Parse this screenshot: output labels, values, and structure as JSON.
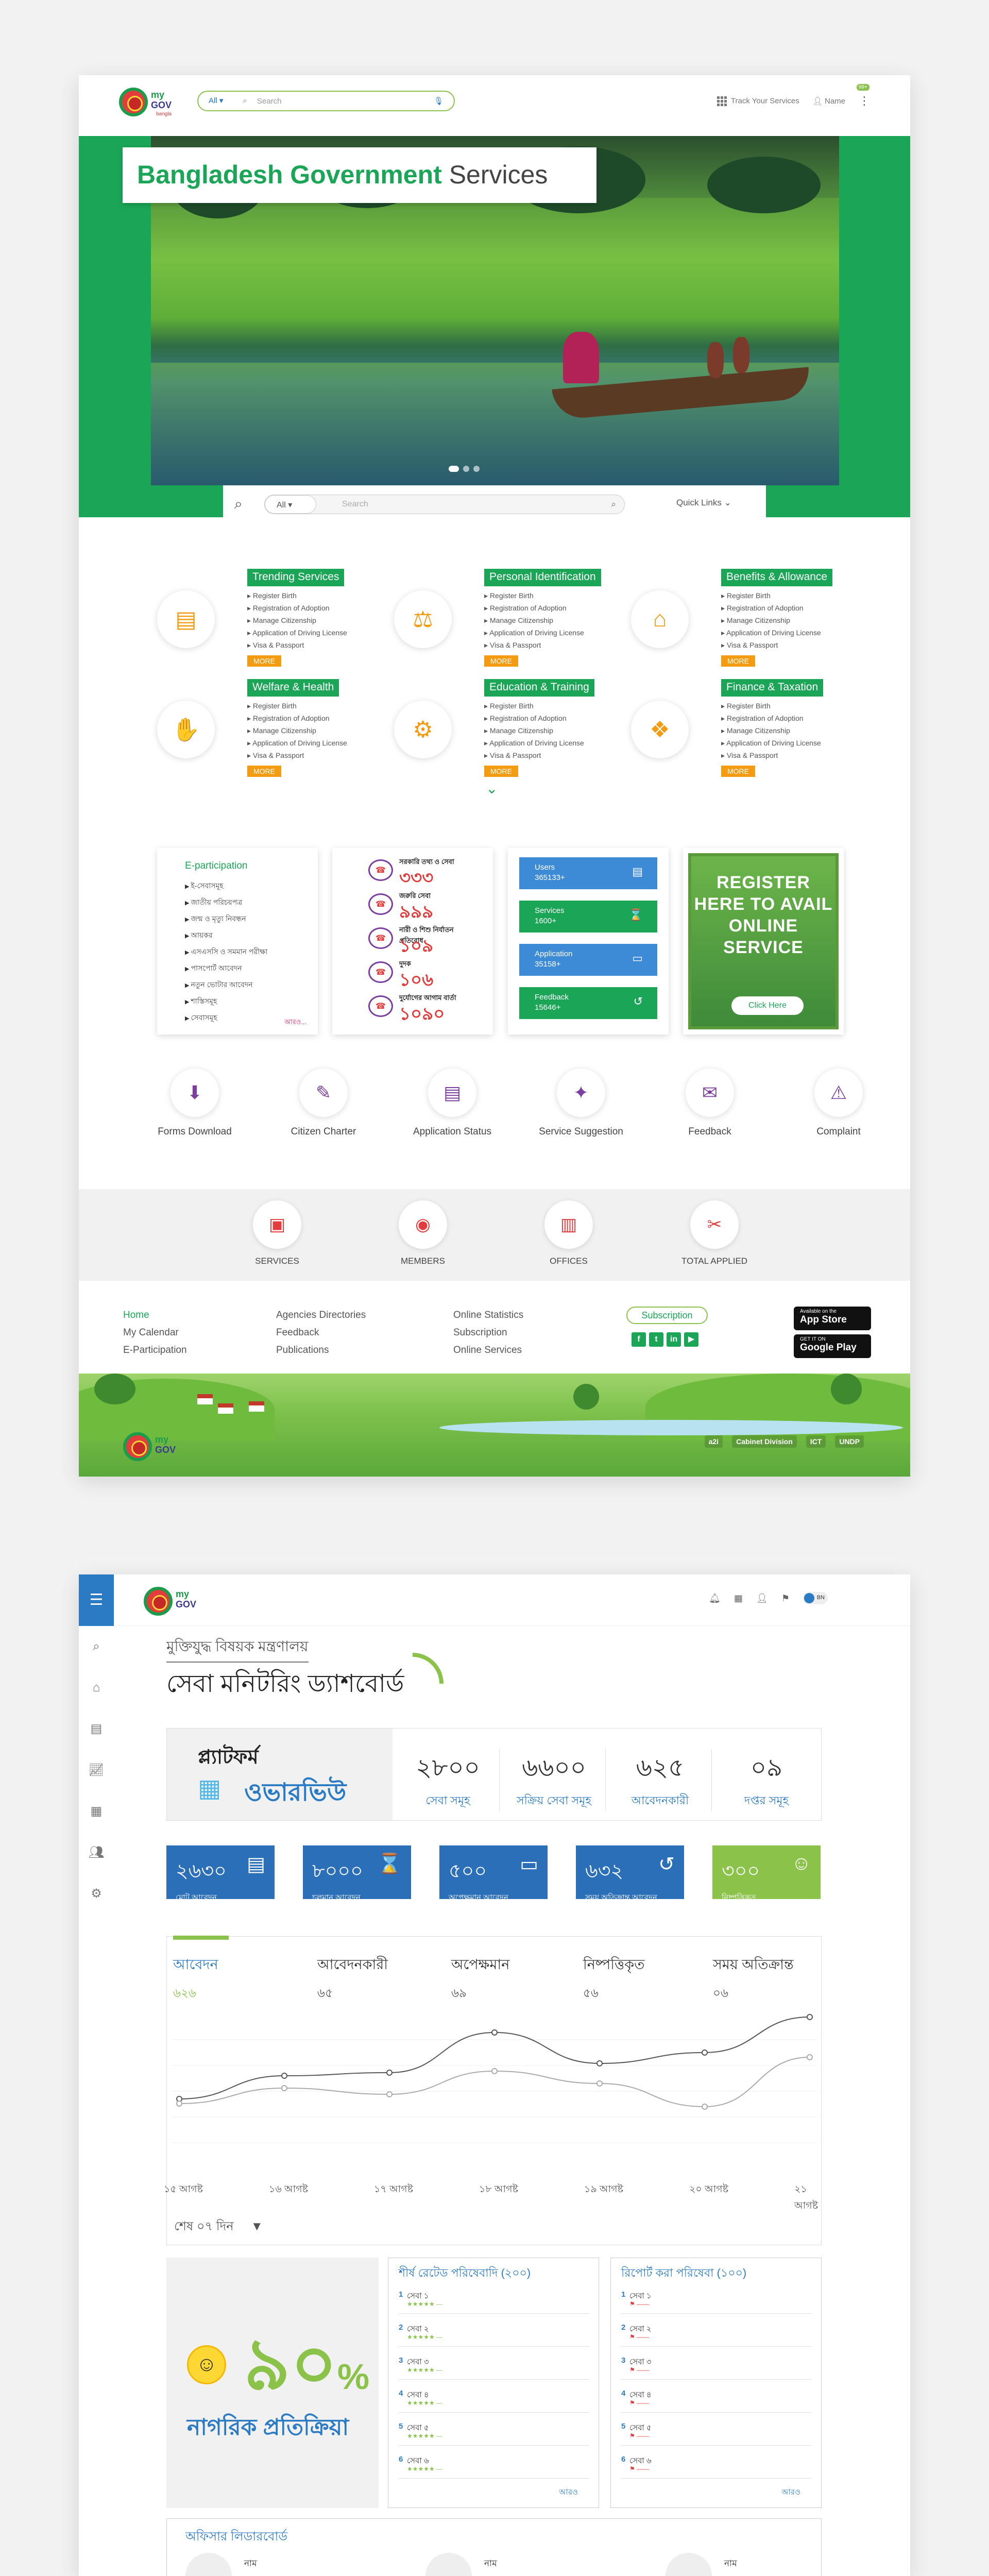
{
  "header": {
    "logo_my": "my",
    "logo_gov": "GOV",
    "logo_sub": "bangla",
    "search_scope": "All ▾",
    "search_placeholder": "Search",
    "track_label": "Track Your Services",
    "user_label": "Name",
    "badge": "99+"
  },
  "hero": {
    "title_bold": "Bangladesh Government",
    "title_rest": " Services",
    "search_scope": "All",
    "search_placeholder": "Search",
    "quick_links": "Quick Links"
  },
  "categories": [
    {
      "title": "Trending Services",
      "icon": "document-icon",
      "items": [
        "Register Birth",
        "Registration of Adoption",
        "Manage Citizenship",
        "Application of Driving License",
        "Visa & Passport"
      ],
      "more": "MORE"
    },
    {
      "title": "Personal Identification",
      "icon": "id-icon",
      "items": [
        "Register Birth",
        "Registration of Adoption",
        "Manage Citizenship",
        "Application of Driving License",
        "Visa & Passport"
      ],
      "more": "MORE"
    },
    {
      "title": "Benefits & Allowance",
      "icon": "building-icon",
      "items": [
        "Register Birth",
        "Registration of Adoption",
        "Manage Citizenship",
        "Application of Driving License",
        "Visa & Passport"
      ],
      "more": "MORE"
    },
    {
      "title": "Welfare & Health",
      "icon": "health-hand-icon",
      "items": [
        "Register Birth",
        "Registration of Adoption",
        "Manage Citizenship",
        "Application of Driving License",
        "Visa & Passport"
      ],
      "more": "MORE"
    },
    {
      "title": "Education & Training",
      "icon": "gear-icon",
      "items": [
        "Register Birth",
        "Registration of Adoption",
        "Manage Citizenship",
        "Application of Driving License",
        "Visa & Passport"
      ],
      "more": "MORE"
    },
    {
      "title": "Finance & Taxation",
      "icon": "money-hand-icon",
      "items": [
        "Register Birth",
        "Registration of Adoption",
        "Manage Citizenship",
        "Application of Driving License",
        "Visa & Passport"
      ],
      "more": "MORE"
    }
  ],
  "eparticipation": {
    "title": "E-participation",
    "items": [
      "ই-সেবাসমূহ",
      "জাতীয় পরিচয়পত্র",
      "জন্ম ও মৃত্যু নিবন্ধন",
      "আয়কর",
      "এসএসসি ও সমমান পরীক্ষা",
      "পাসপোর্ট আবেদন",
      "নতুন ভোটার আবেদন",
      "শাস্তিসমূহ",
      "সেবাসমূহ"
    ],
    "more": "আরও..."
  },
  "hotlines": [
    {
      "label": "সরকারি তথ্য ও সেবা",
      "number": "৩৩৩"
    },
    {
      "label": "জরুরি সেবা",
      "number": "৯৯৯"
    },
    {
      "label": "নারী ও শিশু নির্যাতন প্রতিরোধ",
      "number": "১০৯"
    },
    {
      "label": "দুদক",
      "number": "১০৬"
    },
    {
      "label": "দুর্যোগের আগাম বার্তা",
      "number": "১০৯০"
    }
  ],
  "stats": [
    {
      "label": "Users",
      "value": "365133+",
      "color": "#3d8bd6",
      "icon": "document-icon"
    },
    {
      "label": "Services",
      "value": "1600+",
      "color": "#1aa656",
      "icon": "hourglass-icon"
    },
    {
      "label": "Application",
      "value": "35158+",
      "color": "#3d8bd6",
      "icon": "monitor-icon"
    },
    {
      "label": "Feedback",
      "value": "15646+",
      "color": "#1aa656",
      "icon": "history-icon"
    }
  ],
  "register": {
    "text": "REGISTER HERE TO AVAIL ONLINE SERVICE",
    "button": "Click Here"
  },
  "tools": [
    {
      "label": "Forms Download",
      "icon": "download-icon"
    },
    {
      "label": "Citizen Charter",
      "icon": "charter-icon"
    },
    {
      "label": "Application Status",
      "icon": "status-icon"
    },
    {
      "label": "Service Suggestion",
      "icon": "bulb-icon"
    },
    {
      "label": "Feedback",
      "icon": "chat-icon"
    },
    {
      "label": "Complaint",
      "icon": "complaint-icon"
    }
  ],
  "counts": [
    {
      "label": "SERVICES",
      "icon": "services-icon"
    },
    {
      "label": "MEMBERS",
      "icon": "members-icon"
    },
    {
      "label": "OFFICES",
      "icon": "offices-icon"
    },
    {
      "label": "TOTAL APPLIED",
      "icon": "applied-icon"
    }
  ],
  "footer": {
    "col1": [
      "Home",
      "My Calendar",
      "E-Participation"
    ],
    "col2": [
      "Agencies Directories",
      "Feedback",
      "Publications"
    ],
    "col3": [
      "Online Statistics",
      "Subscription",
      "Online Services"
    ],
    "subscription": "Subscription",
    "socials": [
      "f",
      "t",
      "in",
      "▶"
    ],
    "appstore_small": "Available on the",
    "appstore": "App Store",
    "googleplay_small": "GET IT ON",
    "googleplay": "Google Play",
    "partners": [
      "a2i",
      "Cabinet Division",
      "ICT",
      "UNDP"
    ]
  },
  "dashboard": {
    "lang": "BN",
    "ministry": "মুক্তিযুদ্ধ বিষয়ক মন্ত্রণালয়",
    "title": "সেবা মনিটরিং ড্যাশবোর্ড",
    "platform": "প্ল্যাটফর্ম",
    "overview": "ওভারভিউ",
    "overview_stats": [
      {
        "value": "২৮০০",
        "label": "সেবা সমূহ"
      },
      {
        "value": "৬৬০০",
        "label": "সক্রিয় সেবা সমূহ"
      },
      {
        "value": "৬২৫",
        "label": "আবেদনকারী"
      },
      {
        "value": "০৯",
        "label": "দপ্তর সমূহ"
      }
    ],
    "tiles": [
      {
        "value": "২৬৩০",
        "label": "মোট আবেদন",
        "color": "#2b6fb8",
        "icon": "document-icon"
      },
      {
        "value": "৮০০০",
        "label": "চলমান আবেদন",
        "color": "#2b6fb8",
        "icon": "hourglass-icon"
      },
      {
        "value": "৫০০",
        "label": "অপেক্ষমান আবেদন",
        "color": "#2b6fb8",
        "icon": "monitor-icon"
      },
      {
        "value": "৬৩২",
        "label": "সময় অতিক্রান্ত আবেদন",
        "color": "#2b6fb8",
        "icon": "history-icon"
      },
      {
        "value": "৩০০",
        "label": "নিষ্পত্তিকৃত",
        "color": "#8bc34a",
        "icon": "smile-icon"
      }
    ],
    "chart_tabs": [
      {
        "label": "আবেদন",
        "value": "৬২৬"
      },
      {
        "label": "আবেদনকারী",
        "value": "৬৫"
      },
      {
        "label": "অপেক্ষমান",
        "value": "৬৯"
      },
      {
        "label": "নিষ্পত্তিকৃত",
        "value": "৫৬"
      },
      {
        "label": "সময় অতিক্রান্ত",
        "value": "০৬"
      }
    ],
    "period": "শেষ ০৭ দিন",
    "feedback_pct": "৯০",
    "feedback_label": "নাগরিক প্রতিক্রিয়া",
    "top_title": "শীর্ষ রেটেড পরিষেবাদি (২০০)",
    "top_items": [
      "সেবা ১",
      "সেবা ২",
      "সেবা ৩",
      "সেবা ৪",
      "সেবা ৫",
      "সেবা ৬"
    ],
    "reported_title": "রিপোর্ট করা পরিষেবা (১০০)",
    "reported_items": [
      "সেবা ১",
      "সেবা ২",
      "সেবা ৩",
      "সেবা ৪",
      "সেবা ৫",
      "সেবা ৬"
    ],
    "more": "আরও",
    "leader_title": "অফিসার লিডারবোর্ড",
    "leader_names": [
      "নাম",
      "নাম",
      "নাম"
    ]
  },
  "chart_data": {
    "type": "line",
    "x": [
      "১৫ আগষ্ট",
      "১৬ আগষ্ট",
      "১৭ আগষ্ট",
      "১৮ আগষ্ট",
      "১৯ আগষ্ট",
      "২০ আগষ্ট",
      "২১ আগষ্ট"
    ],
    "series": [
      {
        "values": [
          45,
          60,
          62,
          88,
          68,
          75,
          98
        ]
      },
      {
        "values": [
          42,
          52,
          48,
          63,
          55,
          40,
          72
        ]
      }
    ],
    "ylim": [
      0,
      100
    ],
    "grid": true
  }
}
